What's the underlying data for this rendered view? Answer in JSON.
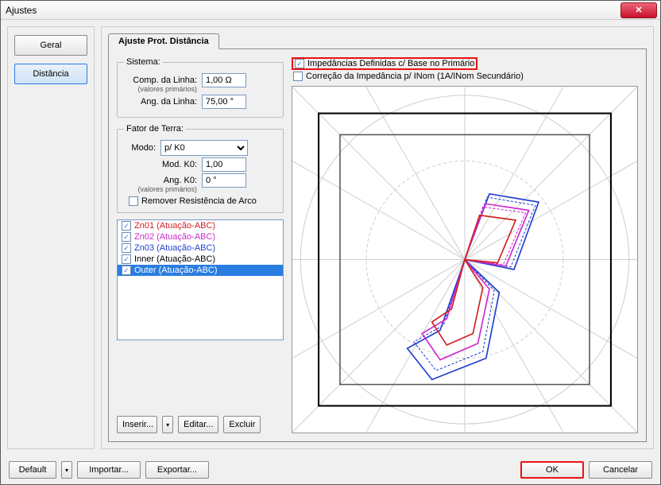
{
  "window": {
    "title": "Ajustes"
  },
  "nav": {
    "geral": "Geral",
    "distancia": "Distância"
  },
  "tab": {
    "label": "Ajuste Prot. Distância"
  },
  "sistema": {
    "legend": "Sistema:",
    "comp_label": "Comp. da Linha:",
    "comp_value": "1,00 Ω",
    "valores_primarios": "(valores primários)",
    "ang_label": "Ang. da Linha:",
    "ang_value": "75,00 °"
  },
  "fator": {
    "legend": "Fator de Terra:",
    "modo_label": "Modo:",
    "modo_value": "p/ K0",
    "modk0_label": "Mod. K0:",
    "modk0_value": "1,00",
    "angk0_label": "Ang. K0:",
    "angk0_value": "0 °",
    "valores_primarios": "(valores primários)",
    "remover_label": "Remover Resistência de Arco"
  },
  "zones": {
    "items": [
      {
        "label": "Zn01 (Atuação-ABC)",
        "color": "#d02020"
      },
      {
        "label": "Zn02 (Atuação-ABC)",
        "color": "#d028d0"
      },
      {
        "label": "Zn03 (Atuação-ABC)",
        "color": "#2040d0"
      },
      {
        "label": "Inner (Atuação-ABC)",
        "color": "#000000"
      },
      {
        "label": "Outer (Atuação-ABC)",
        "color": "#000000"
      }
    ],
    "selected_index": 4
  },
  "zone_btns": {
    "inserir": "Inserir...",
    "editar": "Editar...",
    "excluir": "Excluir"
  },
  "checks": {
    "imped": "Impedâncias Definidas c/ Base no Primário",
    "correcao": "Correção da Impedância p/ INom (1A/INom Secundário)"
  },
  "footer": {
    "default": "Default",
    "importar": "Importar...",
    "exportar": "Exportar...",
    "ok": "OK",
    "cancelar": "Cancelar"
  },
  "chart_data": {
    "type": "polar-impedance-plot",
    "title": "",
    "axes": {
      "x_range": [
        -1,
        1
      ],
      "y_range": [
        -1,
        1
      ]
    },
    "radial_gridlines": 16,
    "concentric_circles": 2,
    "zone_shapes": [
      {
        "name": "Zn01",
        "color": "#d02020",
        "shape": "quadrilateral",
        "vertices": [
          [
            0,
            0
          ],
          [
            0.12,
            0.28
          ],
          [
            0.28,
            0.26
          ],
          [
            0.18,
            -0.02
          ]
        ]
      },
      {
        "name": "Zn02",
        "color": "#d028d0",
        "shape": "quadrilateral",
        "vertices": [
          [
            0,
            0
          ],
          [
            0.14,
            0.34
          ],
          [
            0.34,
            0.3
          ],
          [
            0.22,
            -0.04
          ]
        ]
      },
      {
        "name": "Zn03",
        "color": "#2040d0",
        "shape": "quadrilateral",
        "vertices": [
          [
            0,
            0
          ],
          [
            0.16,
            0.4
          ],
          [
            0.4,
            0.34
          ],
          [
            0.26,
            -0.06
          ]
        ]
      },
      {
        "name": "Inner",
        "color": "#404040",
        "shape": "rectangle",
        "vertices": [
          [
            -0.7,
            -0.7
          ],
          [
            0.7,
            -0.7
          ],
          [
            0.7,
            0.7
          ],
          [
            -0.7,
            0.7
          ]
        ]
      },
      {
        "name": "Outer",
        "color": "#000000",
        "shape": "rectangle",
        "vertices": [
          [
            -0.85,
            -0.85
          ],
          [
            0.85,
            -0.85
          ],
          [
            0.85,
            0.85
          ],
          [
            -0.85,
            0.85
          ]
        ]
      }
    ],
    "lens_shapes": [
      {
        "color": "#2040d0",
        "style": "solid"
      },
      {
        "color": "#d028d0",
        "style": "solid"
      },
      {
        "color": "#d02020",
        "style": "solid"
      }
    ]
  }
}
